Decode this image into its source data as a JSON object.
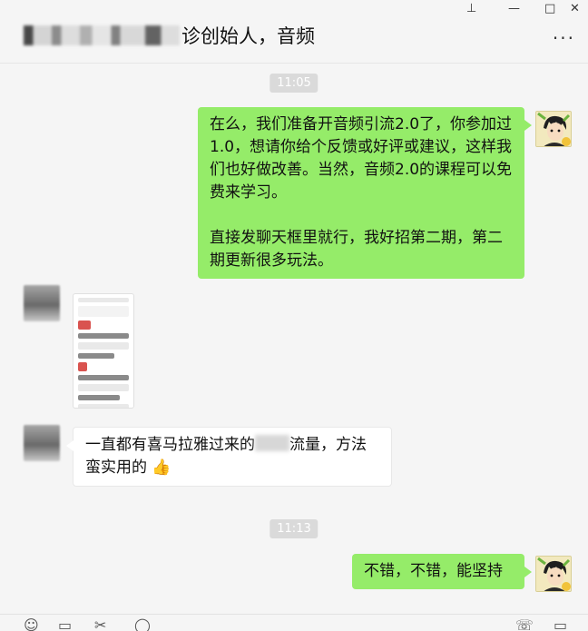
{
  "window": {
    "title_visible": "诊创始人，音频",
    "controls": [
      "unpin-icon",
      "minimize-icon",
      "maximize-icon",
      "close-icon"
    ]
  },
  "messages": [
    {
      "type": "time",
      "text": "11:05"
    },
    {
      "type": "text",
      "from": "me",
      "para1": "在么，我们准备开音频引流2.0了，你参加过1.0，想请你给个反馈或好评或建议，这样我们也好做改善。当然，音频2.0的课程可以免费来学习。",
      "para2": "直接发聊天框里就行，我好招第二期，第二期更新很多玩法。"
    },
    {
      "type": "image",
      "from": "other"
    },
    {
      "type": "text",
      "from": "other",
      "text_a": "一直都有喜马拉雅过来的",
      "text_b": "流量，方法蛮实用的",
      "emoji": "👍"
    },
    {
      "type": "time",
      "text": "11:13"
    },
    {
      "type": "text",
      "from": "me",
      "text": "不错，不错，能坚持"
    }
  ],
  "toolbar": {
    "icons": [
      "emoji-icon",
      "folder-icon",
      "scissors-icon",
      "chat-history-icon",
      "call-icon",
      "video-call-icon"
    ]
  },
  "colors": {
    "self_bubble": "#95ec69",
    "other_bubble": "#ffffff",
    "background": "#f5f5f5",
    "time_badge": "#dadada"
  }
}
